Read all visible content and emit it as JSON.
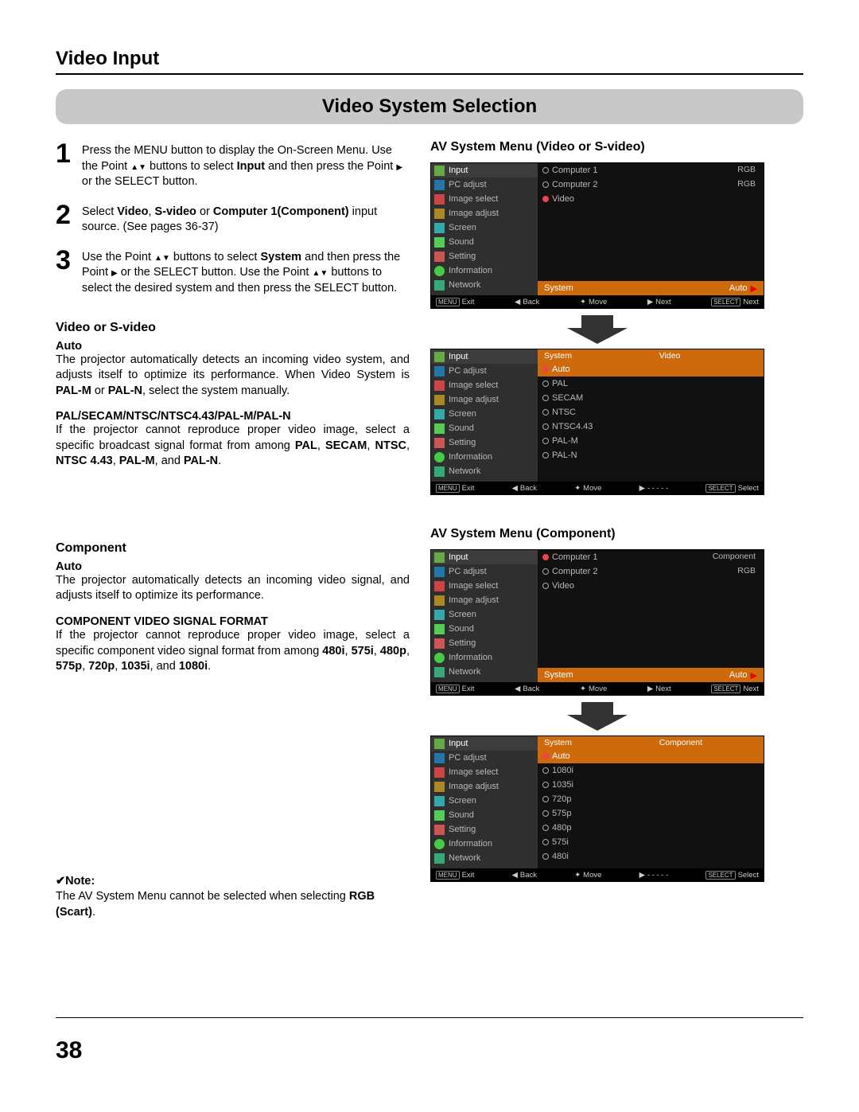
{
  "page": {
    "section_title": "Video Input",
    "subsection_title": "Video System Selection",
    "page_number": "38"
  },
  "steps": [
    {
      "num": "1",
      "text_pre": "Press the MENU button to display the On-Screen Menu. Use the Point ",
      "text_mid1": " buttons to select ",
      "bold1": "Input",
      "text_mid2": " and then press the Point ",
      "text_end": " or the SELECT button."
    },
    {
      "num": "2",
      "text_pre": "Select ",
      "bold1": "Video",
      "sep1": ", ",
      "bold2": "S-video",
      "sep2": " or ",
      "bold3": "Computer 1(Component)",
      "text_end": " input source. (See pages 36-37)"
    },
    {
      "num": "3",
      "text_pre": "Use the Point ",
      "text_mid1": " buttons to select ",
      "bold1": "System",
      "text_mid2": " and then press the Point ",
      "text_mid3": " or the SELECT button. Use the Point ",
      "text_end": " buttons to select the desired system and then press the SELECT button."
    }
  ],
  "video_sv": {
    "heading": "Video or S-video",
    "auto_label": "Auto",
    "auto_para": "The projector automatically detects an incoming video system, and adjusts itself to optimize its performance. When Video System is ",
    "auto_bold1": "PAL-M",
    "auto_mid": " or ",
    "auto_bold2": "PAL-N",
    "auto_end": ", select the system manually.",
    "formats_label": "PAL/SECAM/NTSC/NTSC4.43/PAL-M/PAL-N",
    "formats_para1": "If the projector cannot reproduce proper video image, select a specific broadcast signal format from among ",
    "fb1": "PAL",
    "fs1": ", ",
    "fb2": "SECAM",
    "fs2": ", ",
    "fb3": "NTSC",
    "fs3": ", ",
    "fb4": "NTSC 4.43",
    "fs4": ", ",
    "fb5": "PAL-M",
    "fs5": ", and ",
    "fb6": "PAL-N",
    "fend": "."
  },
  "component": {
    "heading": "Component",
    "auto_label": "Auto",
    "auto_para": "The projector automatically detects an incoming video signal, and adjusts itself to optimize its performance.",
    "cvf_label": "COMPONENT VIDEO SIGNAL FORMAT",
    "cvf_para": "If the projector cannot reproduce proper video image, select a specific component video signal format from among ",
    "cb1": "480i",
    "cs1": ", ",
    "cb2": "575i",
    "cs2": ", ",
    "cb3": "480p",
    "cs3": ", ",
    "cb4": "575p",
    "cs4": ", ",
    "cb5": "720p",
    "cs5": ", ",
    "cb6": "1035i",
    "cs6": ", and ",
    "cb7": "1080i",
    "cend": "."
  },
  "note": {
    "label": "✔Note:",
    "body": "The AV System Menu cannot be selected when selecting ",
    "bold": "RGB (Scart)",
    "end": "."
  },
  "osd": {
    "sidebar_items": [
      "Input",
      "PC adjust",
      "Image select",
      "Image adjust",
      "Screen",
      "Sound",
      "Setting",
      "Information",
      "Network"
    ],
    "heading_video": "AV System Menu (Video or S-video)",
    "heading_component": "AV System Menu (Component)",
    "menu1": {
      "opts": [
        {
          "label": "Computer 1",
          "right": "RGB"
        },
        {
          "label": "Computer 2",
          "right": "RGB"
        },
        {
          "label": "Video",
          "right": "",
          "on": true
        }
      ],
      "system_bar_left": "System",
      "system_bar_right": "Auto"
    },
    "menu2": {
      "header_col1": "System",
      "header_col2": "Video",
      "opts": [
        "Auto",
        "PAL",
        "SECAM",
        "NTSC",
        "NTSC4.43",
        "PAL-M",
        "PAL-N"
      ]
    },
    "menu3": {
      "opts": [
        {
          "label": "Computer 1",
          "right": "Component",
          "on": true
        },
        {
          "label": "Computer 2",
          "right": "RGB"
        },
        {
          "label": "Video",
          "right": ""
        }
      ],
      "system_bar_left": "System",
      "system_bar_right": "Auto"
    },
    "menu4": {
      "header_col1": "System",
      "header_col2": "Component",
      "opts": [
        "Auto",
        "1080i",
        "1035i",
        "720p",
        "575p",
        "480p",
        "575i",
        "480i"
      ]
    },
    "footer": {
      "exit_btn": "MENU",
      "exit": "Exit",
      "back_arrow": "◀",
      "back": "Back",
      "move_arrow": "✦",
      "move": "Move",
      "next_arrow": "▶",
      "next": "Next",
      "select_btn": "SELECT",
      "select_next": "Next",
      "dashes": "- - - - -",
      "select": "Select"
    }
  }
}
